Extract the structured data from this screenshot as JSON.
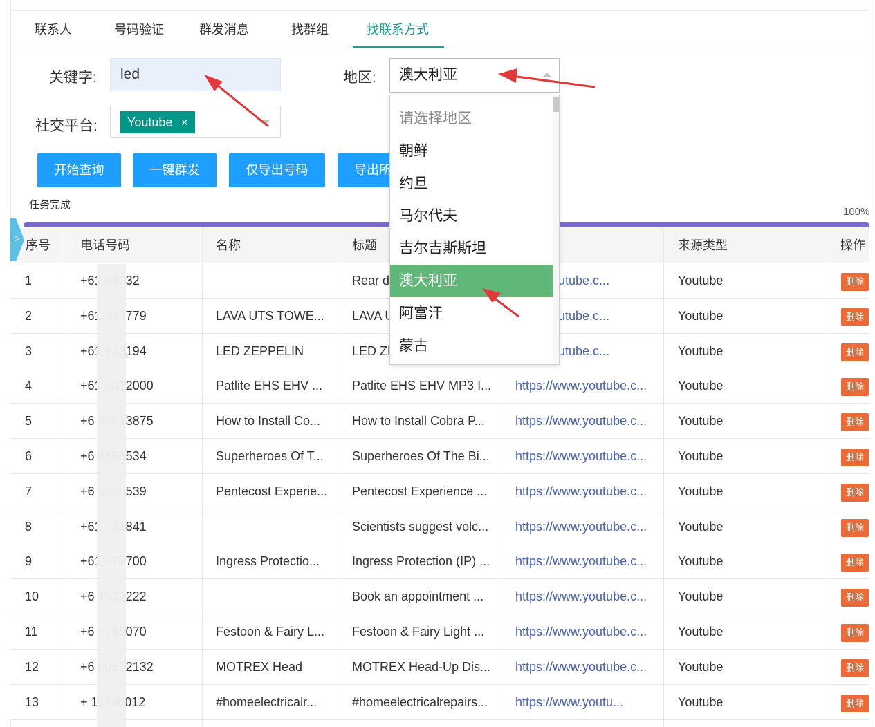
{
  "tabs": [
    {
      "label": "联系人"
    },
    {
      "label": "号码验证"
    },
    {
      "label": "群发消息"
    },
    {
      "label": "找群组"
    },
    {
      "label": "找联系方式",
      "active": true
    }
  ],
  "form": {
    "keyword_label": "关键字:",
    "keyword_value": "led",
    "region_label": "地区:",
    "region_value": "澳大利亚",
    "platform_label": "社交平台:",
    "platform_chip": "Youtube",
    "chip_close": "×"
  },
  "buttons": {
    "query": "开始查询",
    "broadcast": "一键群发",
    "export_numbers": "仅导出号码",
    "export_all": "导出所"
  },
  "progress": {
    "status": "任务完成",
    "percent_label": "100%",
    "value": 100
  },
  "side_toggle": ">",
  "table": {
    "headers": {
      "index": "序号",
      "phone": "电话号码",
      "name": "名称",
      "title": "标题",
      "source": "来源类型",
      "action": "操作"
    },
    "delete_label": "删除",
    "rows": [
      {
        "index": "1",
        "phone": "+61    64032",
        "name": "",
        "title": "Rear dr",
        "link": "www.youtube.c...",
        "source": "Youtube"
      },
      {
        "index": "2",
        "phone": "+61    949779",
        "name": "LAVA UTS TOWE...",
        "title": "LAVA U",
        "link": "www.youtube.c...",
        "source": "Youtube"
      },
      {
        "index": "3",
        "phone": "+61    918194",
        "name": "LED ZEPPELIN",
        "title": "LED ZE",
        "link": "www.youtube.c...",
        "source": "Youtube"
      },
      {
        "index": "4",
        "phone": "+61    0012000",
        "name": "Patlite EHS EHV ...",
        "title": "Patlite EHS EHV MP3 I...",
        "link": "https://www.youtube.c...",
        "source": "Youtube"
      },
      {
        "index": "5",
        "phone": "+6    95613875",
        "name": "How to Install Co...",
        "title": "How to Install Cobra P...",
        "link": "https://www.youtube.c...",
        "source": "Youtube"
      },
      {
        "index": "6",
        "phone": "+6    3858534",
        "name": "Superheroes Of T...",
        "title": "Superheroes Of The Bi...",
        "link": "https://www.youtube.c...",
        "source": "Youtube"
      },
      {
        "index": "7",
        "phone": "+6    5256539",
        "name": "Pentecost Experie...",
        "title": "Pentecost Experience ...",
        "link": "https://www.youtube.c...",
        "source": "Youtube"
      },
      {
        "index": "8",
        "phone": "+61    731841",
        "name": "",
        "title": "Scientists suggest volc...",
        "link": "https://www.youtube.c...",
        "source": "Youtube"
      },
      {
        "index": "9",
        "phone": "+61    479700",
        "name": "Ingress Protectio...",
        "title": "Ingress Protection (IP) ...",
        "link": "https://www.youtube.c...",
        "source": "Youtube"
      },
      {
        "index": "10",
        "phone": "+6    1522222",
        "name": "",
        "title": "Book an appointment ...",
        "link": "https://www.youtube.c...",
        "source": "Youtube"
      },
      {
        "index": "11",
        "phone": "+6    5755070",
        "name": "Festoon & Fairy L...",
        "title": "Festoon & Fairy Light ...",
        "link": "https://www.youtube.c...",
        "source": "Youtube"
      },
      {
        "index": "12",
        "phone": "+6    00512132",
        "name": "MOTREX Head",
        "title": "MOTREX Head-Up Dis...",
        "link": "https://www.youtube.c...",
        "source": "Youtube"
      },
      {
        "index": "13",
        "phone": "+    11798012",
        "name": "#homeelectricalr...",
        "title": "#homeelectricalrepairs...",
        "link": "https://www.youtu...",
        "source": "Youtube"
      }
    ]
  },
  "dropdown": {
    "items": [
      {
        "label": "请选择地区",
        "placeholder": true
      },
      {
        "label": "朝鲜"
      },
      {
        "label": "约旦"
      },
      {
        "label": "马尔代夫"
      },
      {
        "label": "吉尔吉斯斯坦"
      },
      {
        "label": "澳大利亚",
        "selected": true
      },
      {
        "label": "阿富汗"
      },
      {
        "label": "蒙古"
      }
    ]
  },
  "colors": {
    "accent": "#1aa093",
    "button": "#1e9fff",
    "chip": "#009688",
    "progress": "#7b68c8",
    "selected": "#5fb878",
    "delete": "#ea6a38",
    "annotation_arrow": "#e0393a"
  }
}
